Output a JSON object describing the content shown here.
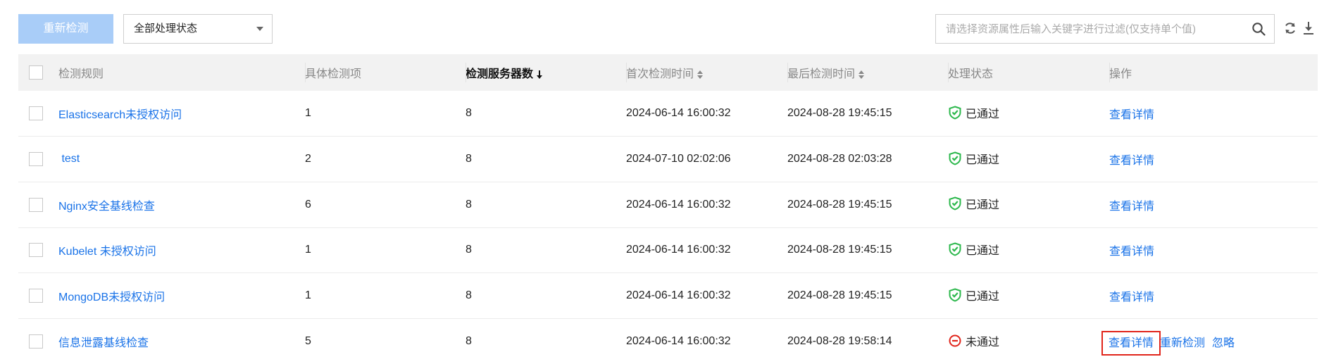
{
  "toolbar": {
    "recheck_label": "重新检测",
    "status_filter_value": "全部处理状态",
    "search_placeholder": "请选择资源属性后输入关键字进行过滤(仅支持单个值)"
  },
  "table": {
    "columns": {
      "rule": "检测规则",
      "items": "具体检测项",
      "servers": "检测服务器数",
      "first_time": "首次检测时间",
      "last_time": "最后检测时间",
      "status": "处理状态",
      "actions": "操作"
    },
    "rows": [
      {
        "rule": "Elasticsearch未授权访问",
        "items": "1",
        "servers": "8",
        "first_time": "2024-06-14 16:00:32",
        "last_time": "2024-08-28 19:45:15",
        "status": "已通过",
        "view": "查看详情"
      },
      {
        "rule": " test",
        "items": "2",
        "servers": "8",
        "first_time": "2024-07-10 02:02:06",
        "last_time": "2024-08-28 02:03:28",
        "status": "已通过",
        "view": "查看详情"
      },
      {
        "rule": "Nginx安全基线检查",
        "items": "6",
        "servers": "8",
        "first_time": "2024-06-14 16:00:32",
        "last_time": "2024-08-28 19:45:15",
        "status": "已通过",
        "view": "查看详情"
      },
      {
        "rule": "Kubelet 未授权访问",
        "items": "1",
        "servers": "8",
        "first_time": "2024-06-14 16:00:32",
        "last_time": "2024-08-28 19:45:15",
        "status": "已通过",
        "view": "查看详情"
      },
      {
        "rule": "MongoDB未授权访问",
        "items": "1",
        "servers": "8",
        "first_time": "2024-06-14 16:00:32",
        "last_time": "2024-08-28 19:45:15",
        "status": "已通过",
        "view": "查看详情"
      },
      {
        "rule": "信息泄露基线检查",
        "items": "5",
        "servers": "8",
        "first_time": "2024-06-14 16:00:32",
        "last_time": "2024-08-28 19:58:14",
        "status": "未通过",
        "view": "查看详情",
        "recheck": "重新检测",
        "ignore": "忽略"
      }
    ]
  },
  "colors": {
    "link": "#1a73e8",
    "pass": "#2db84d",
    "fail": "#e1251b",
    "highlight": "#e1251b",
    "primary_disabled": "#a9cdf8"
  },
  "icons": {
    "search": "search-icon",
    "refresh": "refresh-icon",
    "download": "download-icon",
    "pass": "shield-check-icon",
    "fail": "minus-circle-icon",
    "sort_desc": "arrow-down-icon",
    "sort_both": "sort-updown-icon",
    "dropdown": "chevron-down-icon"
  }
}
